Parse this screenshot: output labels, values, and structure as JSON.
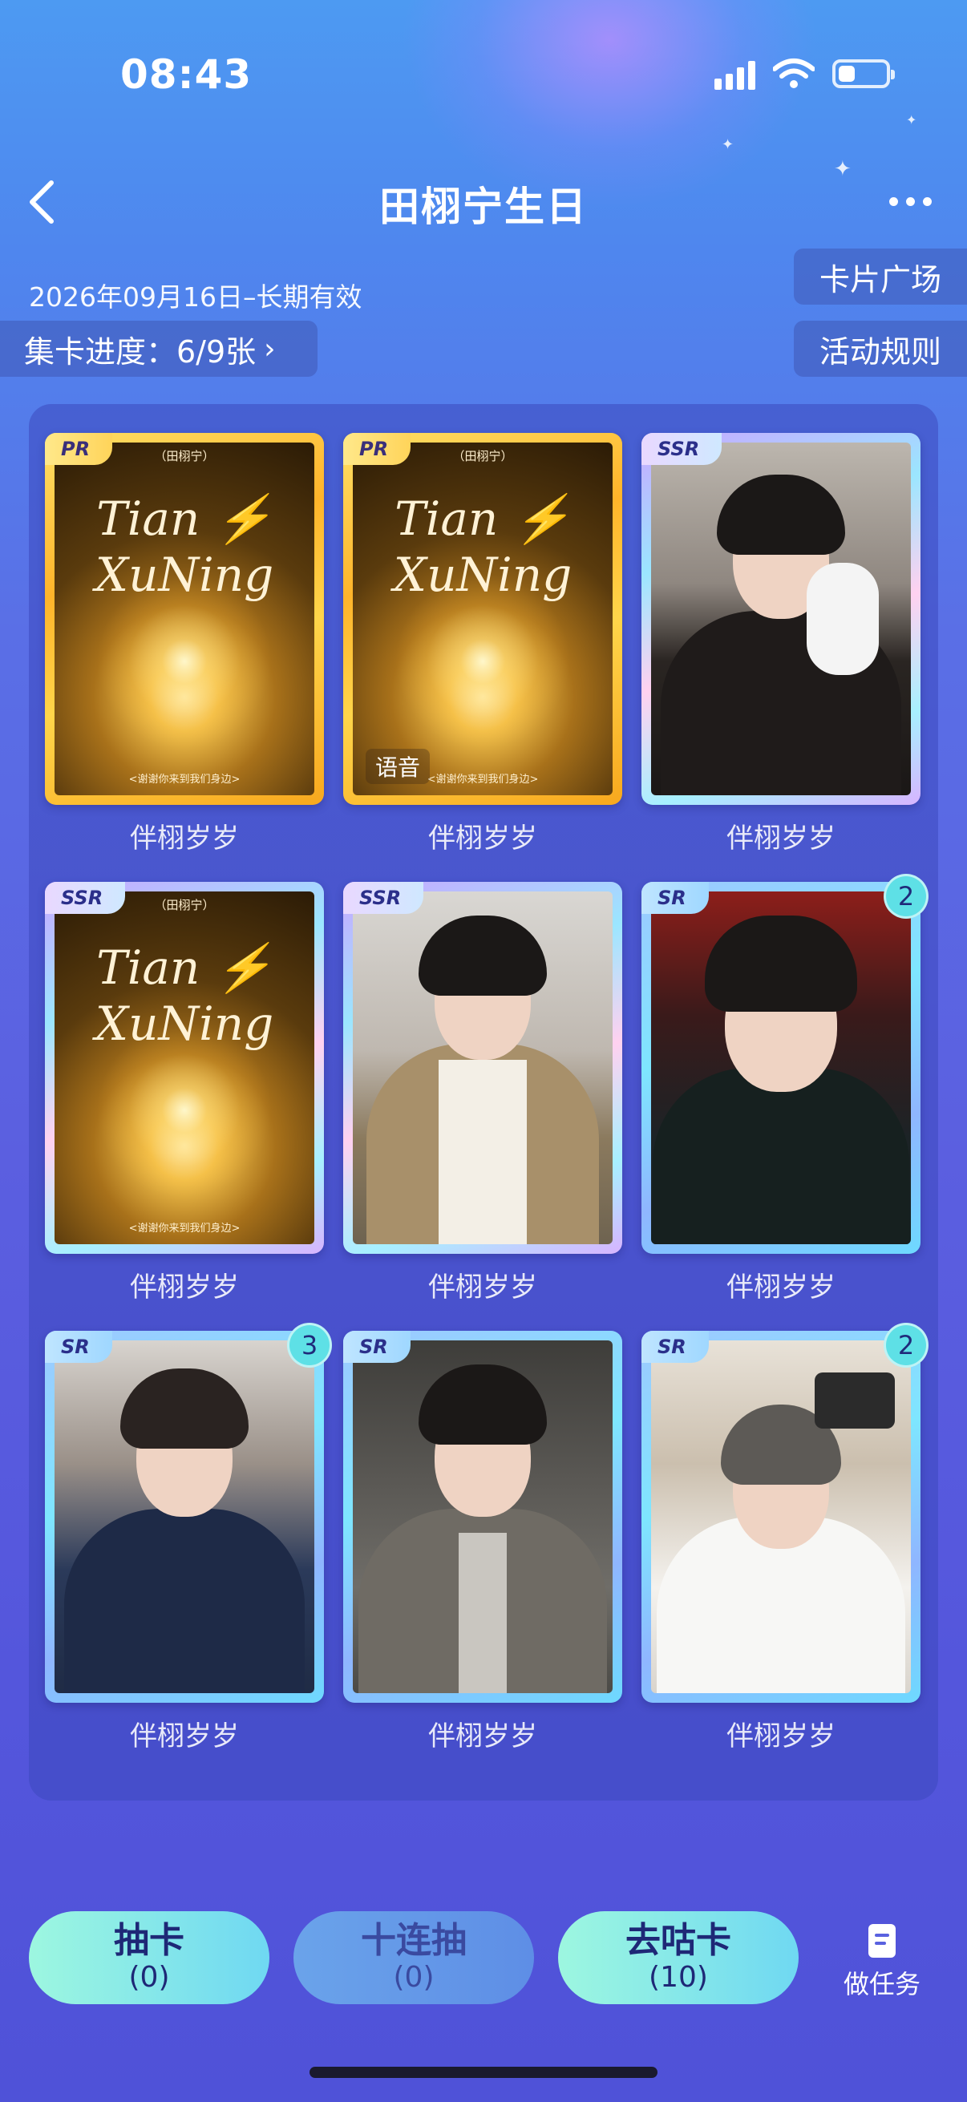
{
  "status": {
    "time": "08:43"
  },
  "header": {
    "title": "田栩宁生日"
  },
  "info": {
    "date_range": "2026年09月16日–长期有效",
    "progress": "集卡进度：6/9张",
    "card_square": "卡片广场",
    "activity_rules": "活动规则"
  },
  "cards": [
    {
      "rarity": "PR",
      "label": "伴栩岁岁",
      "gold_title": "Tian ⚡ XuNing",
      "gold_sub": "（田栩宁）",
      "gold_foot": "<谢谢你来到我们身边>"
    },
    {
      "rarity": "PR",
      "label": "伴栩岁岁",
      "gold_title": "Tian ⚡ XuNing",
      "gold_sub": "（田栩宁）",
      "gold_foot": "<谢谢你来到我们身边>",
      "voice": "语音"
    },
    {
      "rarity": "SSR",
      "label": "伴栩岁岁"
    },
    {
      "rarity": "SSR",
      "label": "伴栩岁岁",
      "gold_title": "Tian ⚡ XuNing",
      "gold_sub": "（田栩宁）",
      "gold_foot": "<谢谢你来到我们身边>"
    },
    {
      "rarity": "SSR",
      "label": "伴栩岁岁"
    },
    {
      "rarity": "SR",
      "label": "伴栩岁岁",
      "count": "2"
    },
    {
      "rarity": "SR",
      "label": "伴栩岁岁",
      "count": "3"
    },
    {
      "rarity": "SR",
      "label": "伴栩岁岁"
    },
    {
      "rarity": "SR",
      "label": "伴栩岁岁",
      "count": "2"
    }
  ],
  "bottom": {
    "draw": {
      "label": "抽卡",
      "count": "(0)"
    },
    "draw10": {
      "label": "十连抽",
      "count": "(0)"
    },
    "goo": {
      "label": "去咕卡",
      "count": "(10)"
    },
    "tasks": {
      "label": "做任务"
    }
  }
}
